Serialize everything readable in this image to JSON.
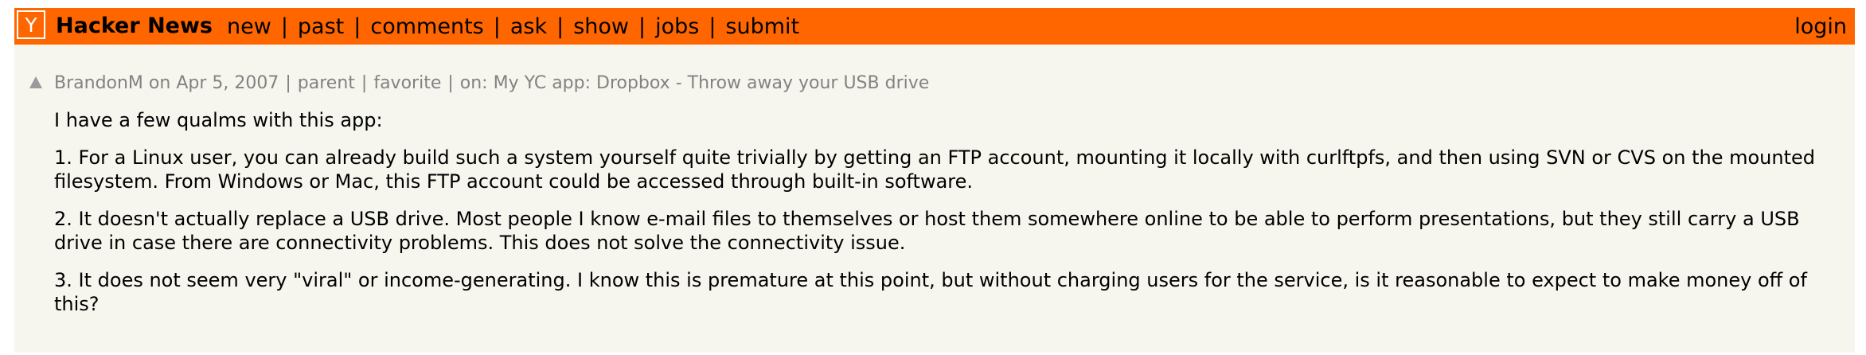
{
  "header": {
    "logo_letter": "Y",
    "site_name": "Hacker News",
    "nav": [
      "new",
      "past",
      "comments",
      "ask",
      "show",
      "jobs",
      "submit"
    ],
    "separator": "|",
    "login_label": "login"
  },
  "comment": {
    "user": "BrandonM",
    "on_word": "on",
    "date": "Apr 5, 2007",
    "parent_label": "parent",
    "favorite_label": "favorite",
    "story_prefix": "on:",
    "story_title": "My YC app: Dropbox - Throw away your USB drive",
    "paragraphs": [
      "I have a few qualms with this app:",
      "1. For a Linux user, you can already build such a system yourself quite trivially by getting an FTP account, mounting it locally with curlftpfs, and then using SVN or CVS on the mounted filesystem. From Windows or Mac, this FTP account could be accessed through built-in software.",
      "2. It doesn't actually replace a USB drive. Most people I know e-mail files to themselves or host them somewhere online to be able to perform presentations, but they still carry a USB drive in case there are connectivity problems. This does not solve the connectivity issue.",
      "3. It does not seem very \"viral\" or income-generating. I know this is premature at this point, but without charging users for the service, is it reasonable to expect to make money off of this?"
    ]
  },
  "colors": {
    "header_bg": "#ff6600",
    "page_bg": "#f6f6ef",
    "meta_text": "#828282"
  }
}
